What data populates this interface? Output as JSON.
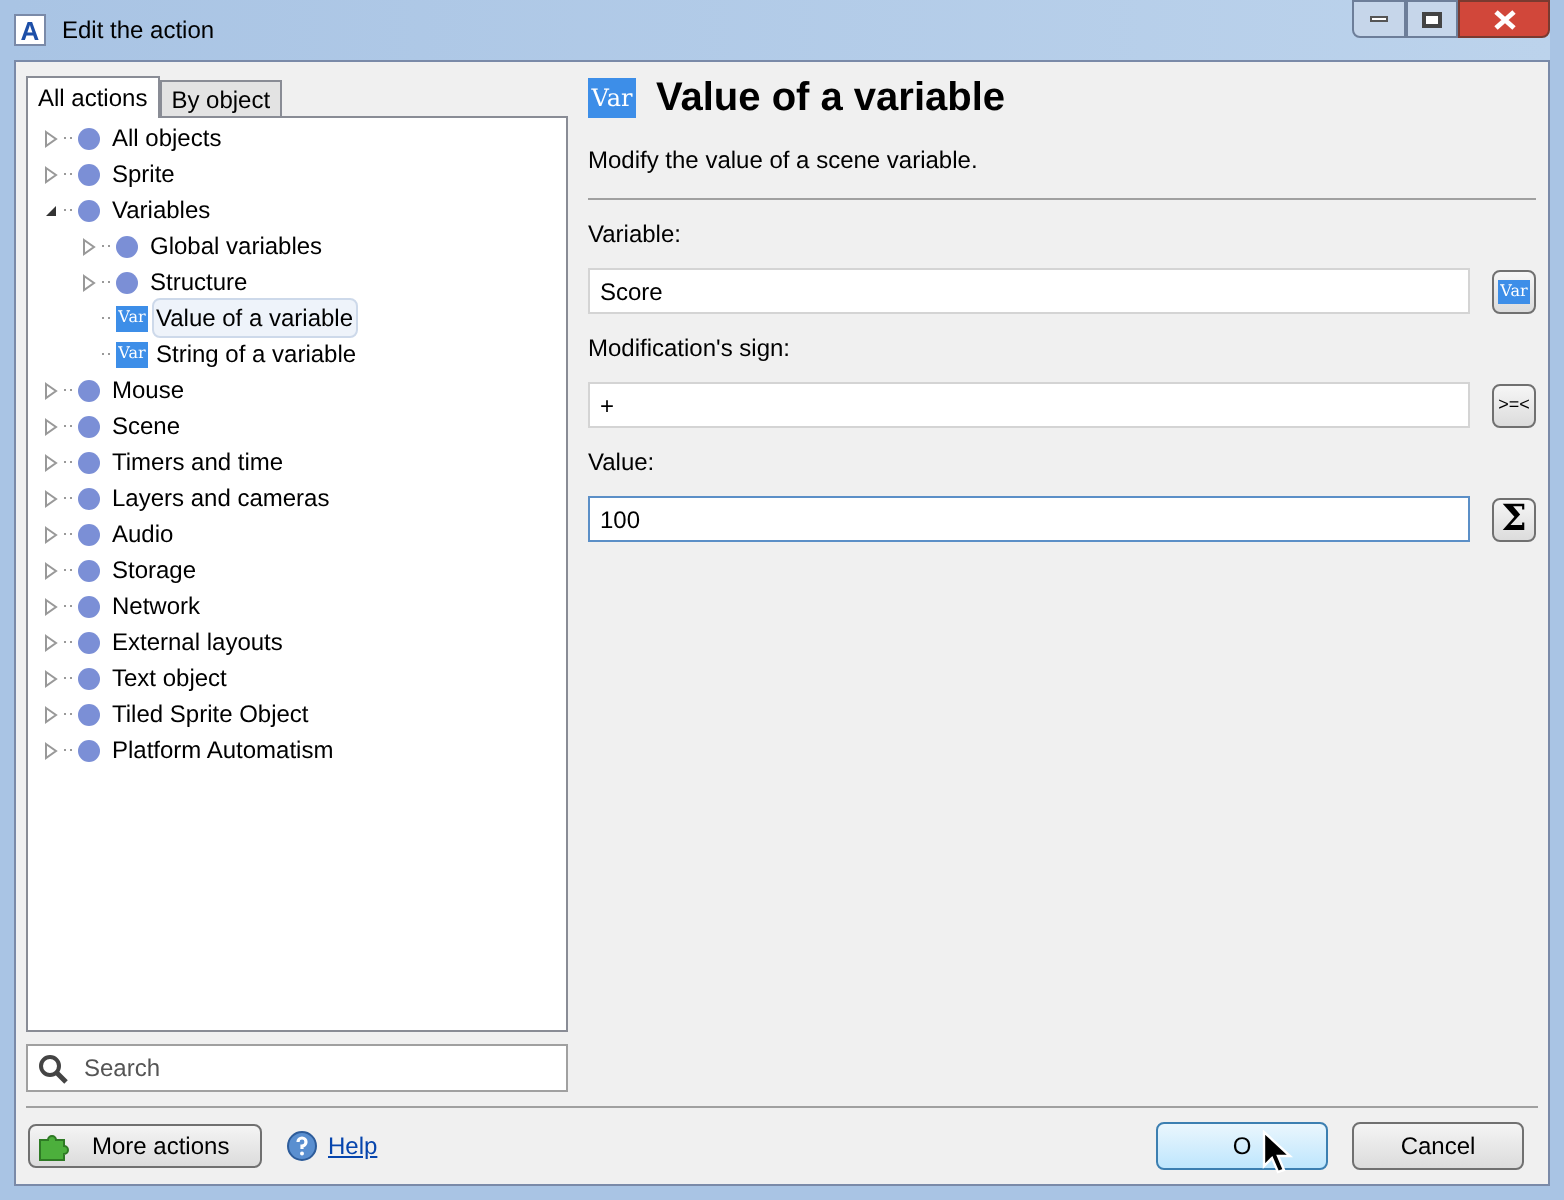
{
  "window": {
    "logo": "A",
    "title": "Edit the action"
  },
  "tabs": [
    {
      "label": "All actions",
      "selected": true
    },
    {
      "label": "By object",
      "selected": false
    }
  ],
  "tree": [
    {
      "label": "All objects",
      "kind": "group",
      "expanded": false,
      "selected": false
    },
    {
      "label": "Sprite",
      "kind": "group",
      "expanded": false,
      "selected": false
    },
    {
      "label": "Variables",
      "kind": "group",
      "expanded": true,
      "selected": false,
      "children": [
        {
          "label": "Global variables",
          "kind": "group",
          "expanded": false,
          "selected": false
        },
        {
          "label": "Structure",
          "kind": "group",
          "expanded": false,
          "selected": false
        },
        {
          "label": "Value of a variable",
          "kind": "action",
          "icon_text": "Var",
          "selected": true
        },
        {
          "label": "String of a variable",
          "kind": "action",
          "icon_text": "Var",
          "selected": false
        }
      ]
    },
    {
      "label": "Mouse",
      "kind": "group",
      "expanded": false,
      "selected": false
    },
    {
      "label": "Scene",
      "kind": "group",
      "expanded": false,
      "selected": false
    },
    {
      "label": "Timers and time",
      "kind": "group",
      "expanded": false,
      "selected": false
    },
    {
      "label": "Layers and cameras",
      "kind": "group",
      "expanded": false,
      "selected": false
    },
    {
      "label": "Audio",
      "kind": "group",
      "expanded": false,
      "selected": false
    },
    {
      "label": "Storage",
      "kind": "group",
      "expanded": false,
      "selected": false
    },
    {
      "label": "Network",
      "kind": "group",
      "expanded": false,
      "selected": false
    },
    {
      "label": "External layouts",
      "kind": "group",
      "expanded": false,
      "selected": false
    },
    {
      "label": "Text object",
      "kind": "group",
      "expanded": false,
      "selected": false
    },
    {
      "label": "Tiled Sprite Object",
      "kind": "group",
      "expanded": false,
      "selected": false
    },
    {
      "label": "Platform Automatism",
      "kind": "group",
      "expanded": false,
      "selected": false
    }
  ],
  "search": {
    "placeholder": "Search"
  },
  "header": {
    "icon_text": "Var",
    "title": "Value of a variable",
    "description": "Modify the value of a scene variable."
  },
  "parameters": [
    {
      "label": "Variable:",
      "value": "Score",
      "focused": false,
      "button": {
        "kind": "variable",
        "text": "Var"
      }
    },
    {
      "label": "Modification's sign:",
      "value": "+",
      "focused": false,
      "button": {
        "kind": "operator",
        "text": ">=<"
      }
    },
    {
      "label": "Value:",
      "value": "100",
      "focused": true,
      "button": {
        "kind": "expression",
        "text": "Σ"
      }
    }
  ],
  "footer": {
    "more_actions": "More actions",
    "help": "Help",
    "ok": "O",
    "cancel": "Cancel"
  }
}
